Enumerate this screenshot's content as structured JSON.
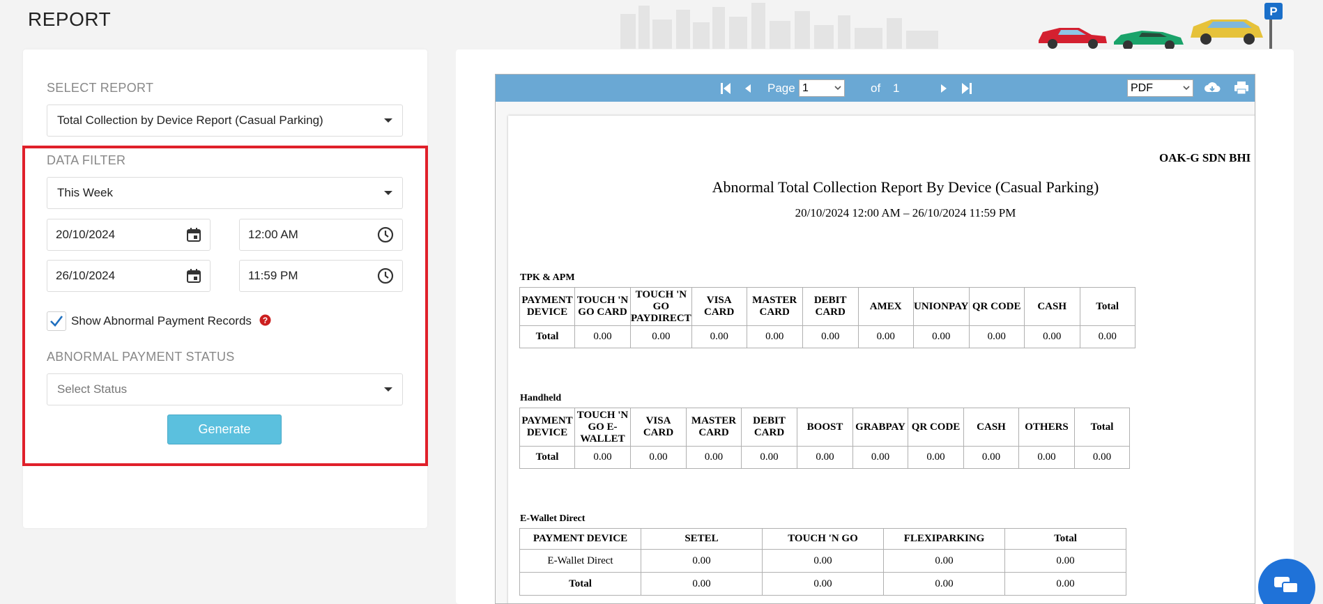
{
  "page": {
    "title": "REPORT"
  },
  "report_select": {
    "label": "SELECT REPORT",
    "value": "Total Collection by Device Report (Casual Parking)"
  },
  "filter": {
    "label": "DATA FILTER",
    "period": "This Week",
    "start_date": "20/10/2024",
    "start_time": "12:00 AM",
    "end_date": "26/10/2024",
    "end_time": "11:59 PM",
    "abnormal_checkbox": {
      "label": "Show Abnormal Payment Records",
      "checked": true
    },
    "status_label": "ABNORMAL PAYMENT STATUS",
    "status_placeholder": "Select Status",
    "generate_label": "Generate"
  },
  "viewer": {
    "page_label": "Page",
    "page_value": "1",
    "of_label": "of",
    "total_pages": "1",
    "format": "PDF"
  },
  "report": {
    "company": "OAK-G SDN BHI",
    "title": "Abnormal Total Collection Report By Device (Casual Parking)",
    "range": "20/10/2024 12:00 AM – 26/10/2024 11:59 PM",
    "groups": [
      {
        "title": "TPK & APM",
        "headers": [
          "PAYMENT DEVICE",
          "TOUCH 'N GO CARD",
          "TOUCH 'N GO PAYDIRECT",
          "VISA CARD",
          "MASTER CARD",
          "DEBIT CARD",
          "AMEX",
          "UNIONPAY",
          "QR CODE",
          "CASH",
          "Total"
        ],
        "rows": [
          [
            "Total",
            "0.00",
            "0.00",
            "0.00",
            "0.00",
            "0.00",
            "0.00",
            "0.00",
            "0.00",
            "0.00",
            "0.00"
          ]
        ]
      },
      {
        "title": "Handheld",
        "headers": [
          "PAYMENT DEVICE",
          "TOUCH 'N GO E-WALLET",
          "VISA CARD",
          "MASTER CARD",
          "DEBIT CARD",
          "BOOST",
          "GRABPAY",
          "QR CODE",
          "CASH",
          "OTHERS",
          "Total"
        ],
        "rows": [
          [
            "Total",
            "0.00",
            "0.00",
            "0.00",
            "0.00",
            "0.00",
            "0.00",
            "0.00",
            "0.00",
            "0.00",
            "0.00"
          ]
        ]
      },
      {
        "title": "E-Wallet Direct",
        "headers": [
          "PAYMENT DEVICE",
          "SETEL",
          "TOUCH 'N GO",
          "FLEXIPARKING",
          "Total"
        ],
        "rows": [
          [
            "E-Wallet Direct",
            "0.00",
            "0.00",
            "0.00",
            "0.00"
          ],
          [
            "Total",
            "0.00",
            "0.00",
            "0.00",
            "0.00"
          ]
        ]
      }
    ]
  },
  "colors": {
    "toolbar": "#6aa8d4",
    "generate": "#5bc0de",
    "highlight": "#e0202a",
    "checkmark": "#1e6fbf",
    "help": "#cc1f1f",
    "chat": "#1f72d8"
  },
  "icons": [
    "calendar-icon",
    "clock-icon",
    "question-icon",
    "first-page-icon",
    "prev-page-icon",
    "next-page-icon",
    "last-page-icon",
    "download-icon",
    "print-icon",
    "parking-icon",
    "chat-icon"
  ]
}
